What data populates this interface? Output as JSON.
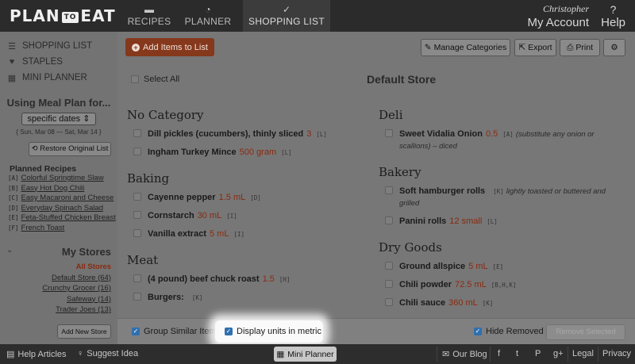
{
  "app": {
    "logo": {
      "plan": "PLAN",
      "to": "TO",
      "eat": "EAT"
    },
    "nav": [
      {
        "label": "RECIPES",
        "icon": "recipes-icon",
        "glyph": "▬"
      },
      {
        "label": "PLANNER",
        "icon": "clock-icon",
        "glyph": "◔"
      },
      {
        "label": "SHOPPING LIST",
        "icon": "checklist-icon",
        "glyph": "✓"
      }
    ],
    "account": {
      "user": "Christopher",
      "label": "My Account"
    },
    "help": {
      "glyph": "?",
      "label": "Help"
    }
  },
  "sidebar": {
    "items": [
      {
        "label": "SHOPPING LIST",
        "glyph": "☰"
      },
      {
        "label": "STAPLES",
        "glyph": "♥"
      },
      {
        "label": "MINI PLANNER",
        "glyph": "▦"
      }
    ],
    "meal_plan_heading": "Using Meal Plan for...",
    "date_select": "specific dates",
    "date_range": "{ Sun, Mar 08 — Sat, Mar 14 }",
    "restore_label": "Restore Original List",
    "planned_heading": "Planned Recipes",
    "recipes": [
      {
        "key": "[A]",
        "title": "Colorful Springtime Slaw"
      },
      {
        "key": "[B]",
        "title": "Easy Hot Dog Chili"
      },
      {
        "key": "[C]",
        "title": "Easy Macaroni and Cheese"
      },
      {
        "key": "[D]",
        "title": "Everyday Spinach Salad"
      },
      {
        "key": "[E]",
        "title": "Feta-Stuffed Chicken Breast"
      },
      {
        "key": "[F]",
        "title": "French Toast"
      }
    ],
    "stores_heading": "My Stores",
    "stores": [
      {
        "label": "All Stores"
      },
      {
        "label": "Default Store (64)"
      },
      {
        "label": "Crunchy Grocer (16)"
      },
      {
        "label": "Safeway (14)"
      },
      {
        "label": "Trader Joes (13)"
      }
    ],
    "add_store_label": "Add New Store"
  },
  "toolbar": {
    "add_items": "Add Items to List",
    "manage_categories": "Manage Categories",
    "export": "Export",
    "print": "Print"
  },
  "list": {
    "select_all": "Select All",
    "store_title": "Default Store",
    "left_categories": [
      {
        "title": "No Category",
        "items": [
          {
            "name": "Dill pickles (cucumbers), thinly sliced",
            "qty": "3",
            "key": "[L]",
            "note": ""
          },
          {
            "name": "Ingham Turkey Mince",
            "qty": "500 gram",
            "key": "[L]",
            "note": ""
          }
        ]
      },
      {
        "title": "Baking",
        "items": [
          {
            "name": "Cayenne pepper",
            "qty": "1.5 mL",
            "key": "[D]",
            "note": ""
          },
          {
            "name": "Cornstarch",
            "qty": "30 mL",
            "key": "[I]",
            "note": ""
          },
          {
            "name": "Vanilla extract",
            "qty": "5 mL",
            "key": "[I]",
            "note": ""
          }
        ]
      },
      {
        "title": "Meat",
        "items": [
          {
            "name": "(4 pound) beef chuck roast",
            "qty": "1.5",
            "key": "[H]",
            "note": ""
          },
          {
            "name": "Burgers:",
            "qty": "",
            "key": "[K]",
            "note": ""
          }
        ]
      }
    ],
    "right_categories": [
      {
        "title": "Deli",
        "items": [
          {
            "name": "Sweet Vidalia Onion",
            "qty": "0.5",
            "key": "[A]",
            "note": "(substitute any onion or scallions) – diced"
          }
        ]
      },
      {
        "title": "Bakery",
        "items": [
          {
            "name": "Soft hamburger rolls",
            "qty": "",
            "key": "[K]",
            "note": "lightly toasted or buttered and grilled"
          },
          {
            "name": "Panini rolls",
            "qty": "12 small",
            "key": "[L]",
            "note": ""
          }
        ]
      },
      {
        "title": "Dry Goods",
        "items": [
          {
            "name": "Ground allspice",
            "qty": "5 mL",
            "key": "[E]",
            "note": ""
          },
          {
            "name": "Chili powder",
            "qty": "72.5 mL",
            "key": "[B,H,K]",
            "note": ""
          },
          {
            "name": "Chili sauce",
            "qty": "360 mL",
            "key": "[K]",
            "note": ""
          }
        ]
      }
    ]
  },
  "options": {
    "group_similar": "Group Similar Items",
    "display_metric": "Display units in metric",
    "hide_removed": "Hide Removed",
    "remove_selected": "Remove Selected"
  },
  "footer": {
    "help_articles": "Help Articles",
    "suggest_idea": "Suggest Idea",
    "mini_planner": "Mini Planner",
    "our_blog": "Our Blog",
    "legal": "Legal",
    "privacy": "Privacy",
    "social": [
      {
        "name": "facebook-icon",
        "glyph": "f"
      },
      {
        "name": "twitter-icon",
        "glyph": "t"
      },
      {
        "name": "pinterest-icon",
        "glyph": "P"
      },
      {
        "name": "googleplus-icon",
        "glyph": "g+"
      }
    ]
  },
  "colors": {
    "accent": "#85381c",
    "qty": "#8b2a10",
    "checkbox": "#2f6fb0"
  }
}
